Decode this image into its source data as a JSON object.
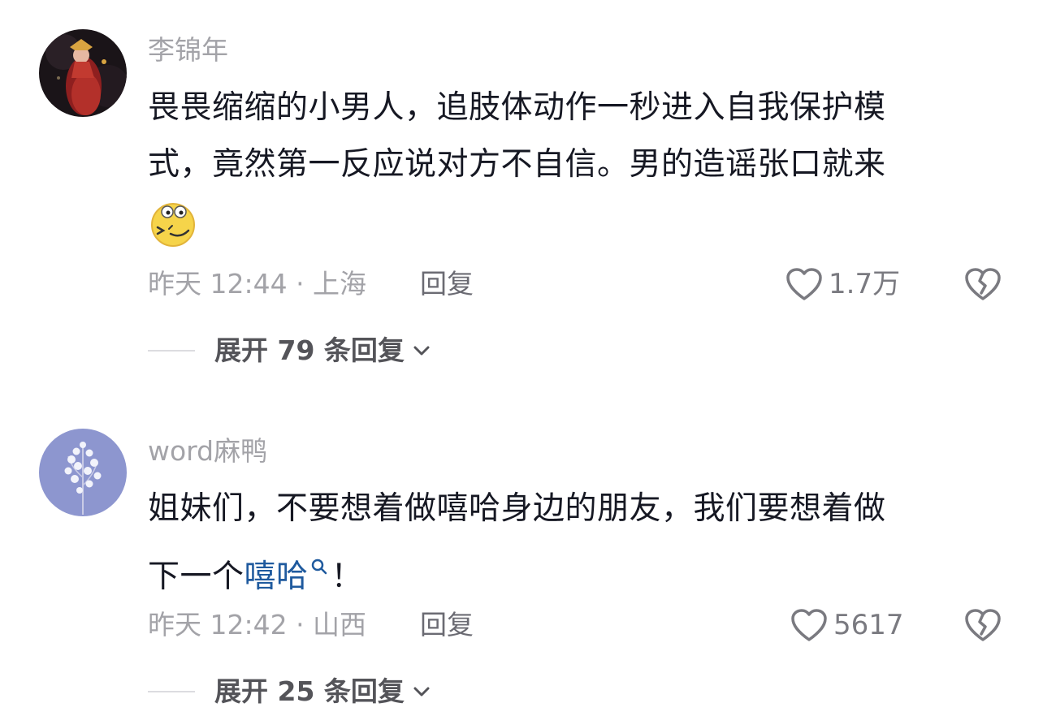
{
  "comments": [
    {
      "username": "李锦年",
      "lines": [
        "畏畏缩缩的小男人，追肢体动作一秒进入自我保护模",
        "式，竟然第一反应说对方不自信。男的造谣张口就来"
      ],
      "emoji": "grimace-emoji",
      "time_location": "昨天 12:44 · 上海",
      "reply_label": "回复",
      "likes": "1.7万",
      "expand_label": "展开 79 条回复"
    },
    {
      "username": "word麻鸭",
      "line1": "姐妹们，不要想着做嘻哈身边的朋友，我们要想着做",
      "line2_prefix": "下一个",
      "line2_link": "嘻哈",
      "line2_suffix": "！",
      "time_location": "昨天 12:42 · 山西",
      "reply_label": "回复",
      "likes": "5617",
      "expand_label": "展开 25 条回复"
    }
  ],
  "icons": {
    "like": "heart-outline-icon",
    "dislike": "broken-heart-icon",
    "expand": "chevron-down-icon",
    "search": "search-icon"
  },
  "colors": {
    "text": "#161823",
    "secondary": "#a3a3a8",
    "link": "#1f5a9e"
  }
}
